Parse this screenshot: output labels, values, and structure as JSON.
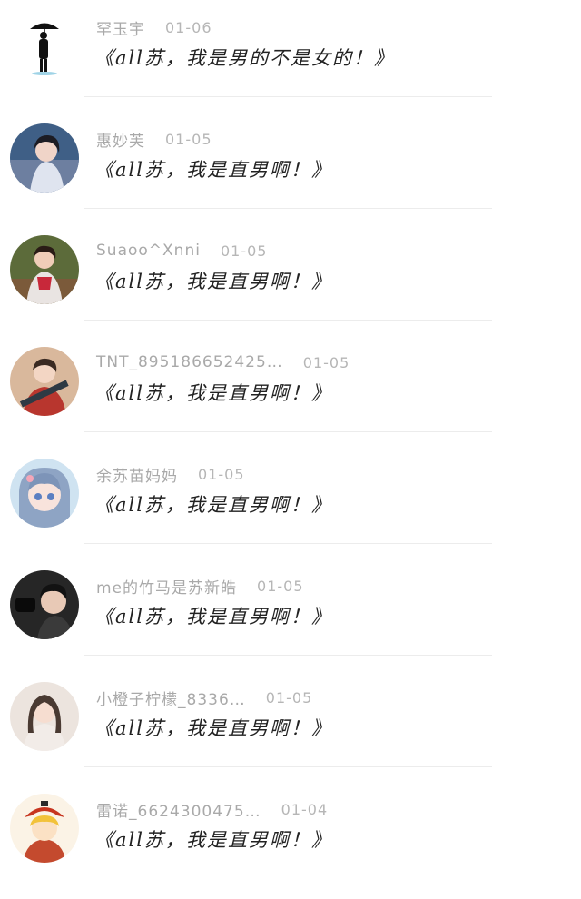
{
  "comments": [
    {
      "name": "罕玉宇",
      "date": "01-06",
      "text": "《all苏，我是男的不是女的！》",
      "avatar": "umbrella-figure"
    },
    {
      "name": "惠妙芙",
      "date": "01-05",
      "text": "《all苏，我是直男啊！》",
      "avatar": "woman-blue"
    },
    {
      "name": "Suaoo^Xnni",
      "date": "01-05",
      "text": "《all苏，我是直男啊！》",
      "avatar": "man-red"
    },
    {
      "name": "TNT_895186652425…",
      "date": "01-05",
      "text": "《all苏，我是直男啊！》",
      "avatar": "boy-guitar"
    },
    {
      "name": "余苏苗妈妈",
      "date": "01-05",
      "text": "《all苏，我是直男啊！》",
      "avatar": "anime-girl"
    },
    {
      "name": "me的竹马是苏新皓",
      "date": "01-05",
      "text": "《all苏，我是直男啊！》",
      "avatar": "boy-dark"
    },
    {
      "name": "小橙子柠檬_8336…",
      "date": "01-05",
      "text": "《all苏，我是直男啊！》",
      "avatar": "girl-light"
    },
    {
      "name": "雷诺_6624300475…",
      "date": "01-04",
      "text": "《all苏，我是直男啊！》",
      "avatar": "cartoon-hat"
    }
  ]
}
